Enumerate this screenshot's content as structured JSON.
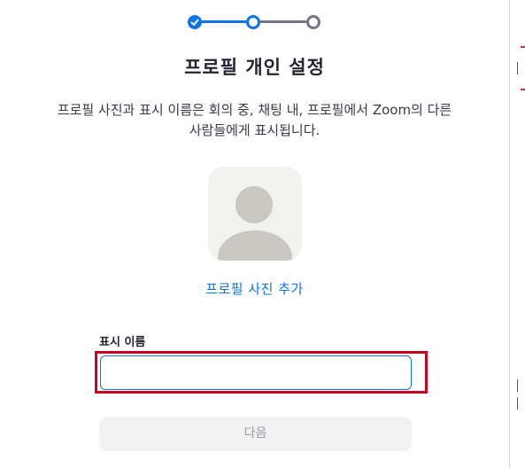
{
  "stepper": {
    "steps": [
      "done",
      "current",
      "todo"
    ],
    "colors": {
      "active": "#0e72ed",
      "inactive": "#747487"
    }
  },
  "header": {
    "title": "프로필 개인 설정",
    "description_line1": "프로필 사진과 표시 이름은 회의 중, 채팅 내, 프로필에서 Zoom의 다른",
    "description_line2": "사람들에게 표시됩니다."
  },
  "avatar": {
    "icon": "default-avatar-icon",
    "add_photo_label": "프로필 사진 추가"
  },
  "display_name": {
    "label": "표시 이름",
    "value": "",
    "placeholder": ""
  },
  "actions": {
    "next_label": "다음"
  },
  "accent": {
    "brand": "#0e72ed",
    "highlight": "#d0021b"
  }
}
